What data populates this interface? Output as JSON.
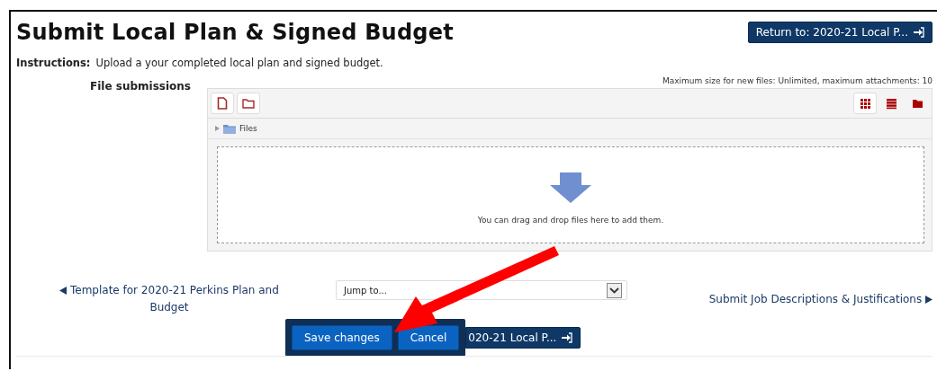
{
  "page": {
    "title": "Submit Local Plan & Signed Budget",
    "return_button": "Return to: 2020-21 Local P..."
  },
  "instructions": {
    "label": "Instructions:",
    "text": "Upload a your completed local plan and signed budget."
  },
  "file_submissions": {
    "label": "File submissions",
    "limits": "Maximum size for new files: Unlimited, maximum attachments: 10",
    "path": "Files",
    "dropzone_text": "You can drag and drop files here to add them.",
    "view_buttons": [
      {
        "kind": "icons",
        "selected": true
      },
      {
        "kind": "list",
        "selected": false
      },
      {
        "kind": "tree",
        "selected": false
      }
    ]
  },
  "navigation": {
    "previous": "Template for 2020-21 Perkins Plan and Budget",
    "jump_placeholder": "Jump to...",
    "next": "Submit Job Descriptions & Justifications"
  },
  "actions": {
    "buttons": [
      "Save changes",
      "Cancel"
    ],
    "covered_return_button": "020-21 Local P..."
  },
  "callout_arrow": true
}
